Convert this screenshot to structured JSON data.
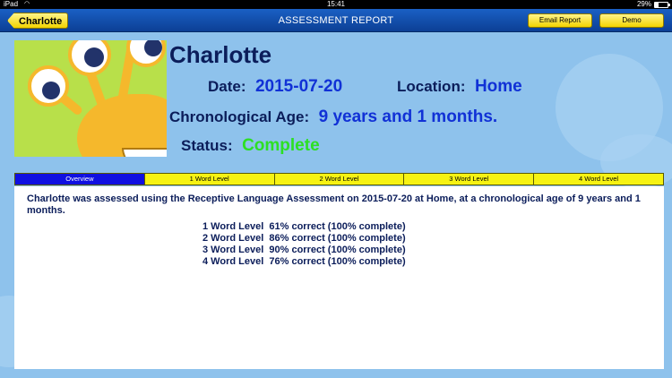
{
  "status_bar": {
    "device": "iPad",
    "time": "15:41",
    "battery": "29%"
  },
  "nav": {
    "back_label": "Charlotte",
    "title": "ASSESSMENT REPORT",
    "email_label": "Email Report",
    "demo_label": "Demo"
  },
  "profile": {
    "name": "Charlotte",
    "date_label": "Date:",
    "date_value": "2015-07-20",
    "location_label": "Location:",
    "location_value": "Home",
    "age_label": "Chronological Age:",
    "age_value": "9 years and 1 months.",
    "status_label": "Status:",
    "status_value": "Complete"
  },
  "tabs": [
    {
      "label": "Overview",
      "active": true
    },
    {
      "label": "1 Word Level",
      "active": false
    },
    {
      "label": "2 Word Level",
      "active": false
    },
    {
      "label": "3 Word Level",
      "active": false
    },
    {
      "label": "4 Word Level",
      "active": false
    }
  ],
  "overview": {
    "summary": "Charlotte was assessed using the Receptive Language Assessment on 2015-07-20 at Home, at a chronological age of 9 years and 1 months.",
    "levels": [
      "1 Word Level  61% correct (100% complete)",
      "2 Word Level  86% correct (100% complete)",
      "3 Word Level  90% correct (100% complete)",
      "4 Word Level  76% correct (100% complete)"
    ]
  },
  "colors": {
    "nav_bar": "#0c3f95",
    "button_yellow": "#f3d400",
    "active_tab": "#1010e0",
    "tab_yellow": "#f6f313",
    "status_complete": "#2ce023",
    "value_blue": "#1131d6",
    "label_navy": "#0b1d5a",
    "background": "#8ec2ec"
  },
  "icons": {
    "wifi": "wifi-icon",
    "battery": "battery-icon",
    "avatar": "monster-avatar"
  }
}
